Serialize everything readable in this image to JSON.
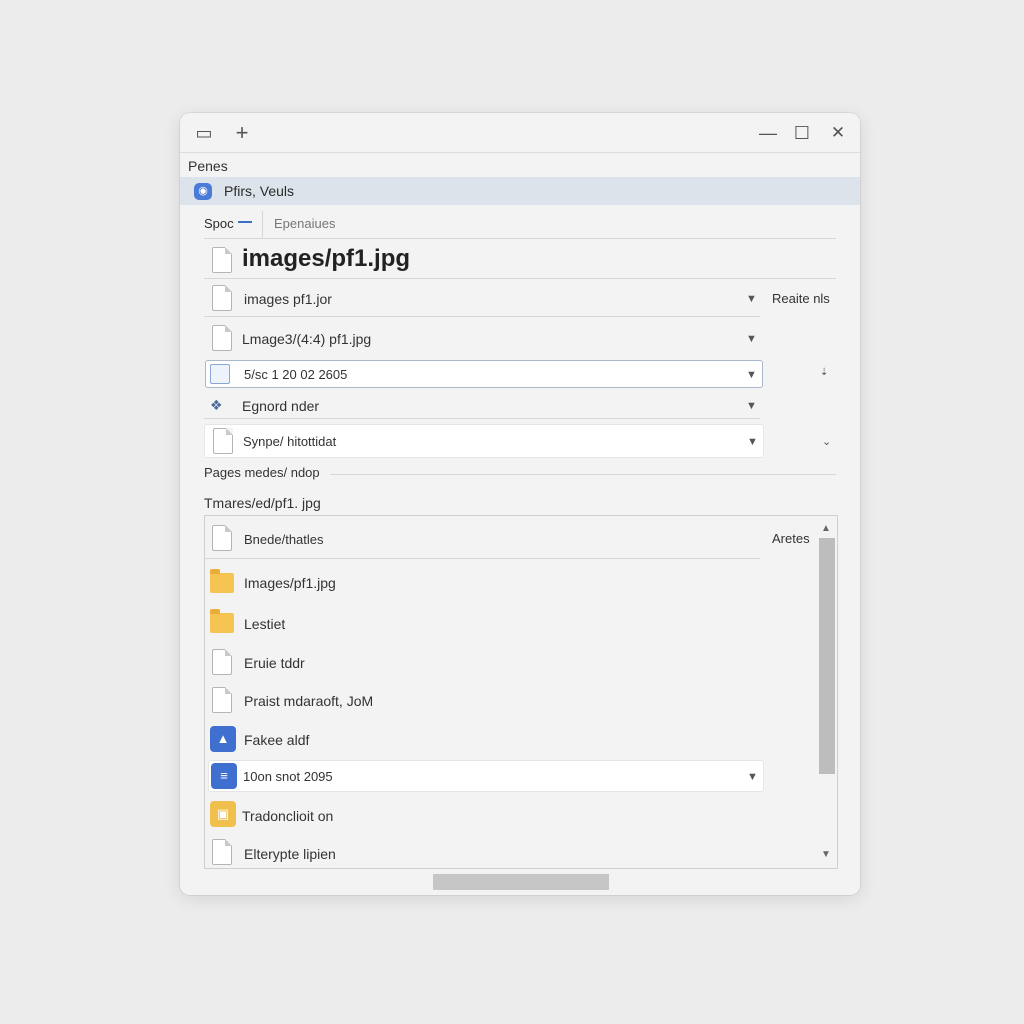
{
  "window": {
    "menu_label": "Penes",
    "selected_item": "Pfirs, Veuls",
    "tabs": [
      "Spoc",
      "Epenaiues"
    ],
    "title": "images/pf1.jpg"
  },
  "rows": [
    {
      "text": "images pf1.jor",
      "right": "Reaite nls"
    },
    {
      "text": "Lmage3/(4:4) pf1.jpg"
    },
    {
      "text": "5/sc 1 20 02 2605"
    },
    {
      "text": "Egnord nder"
    },
    {
      "text": "Synpe/ hitottidat"
    }
  ],
  "sections": {
    "pages": "Pages medes/ ndop",
    "path": "Tmares/ed/pf1. jpg"
  },
  "list": {
    "right_label": "Aretes",
    "items": [
      {
        "text": "Bnede/thatles",
        "icon": "file-icon"
      },
      {
        "text": "Images/pf1.jpg",
        "icon": "folder-icon"
      },
      {
        "text": "Lestiet",
        "icon": "folder-icon"
      },
      {
        "text": "Eruie tddr",
        "icon": "file-icon"
      },
      {
        "text": "Praist mdaraoft, JoM",
        "icon": "file-icon"
      },
      {
        "text": "Fakee aldf",
        "icon": "app-icon"
      },
      {
        "text": "10on snot 2095",
        "icon": "app-icon"
      },
      {
        "text": "Tradonclioit on",
        "icon": "app-icon"
      },
      {
        "text": "Elterypte lipien",
        "icon": "file-icon"
      }
    ]
  },
  "colors": {
    "accent": "#3b6fc4",
    "selection": "#dde3ea",
    "folder": "#f6c453"
  }
}
